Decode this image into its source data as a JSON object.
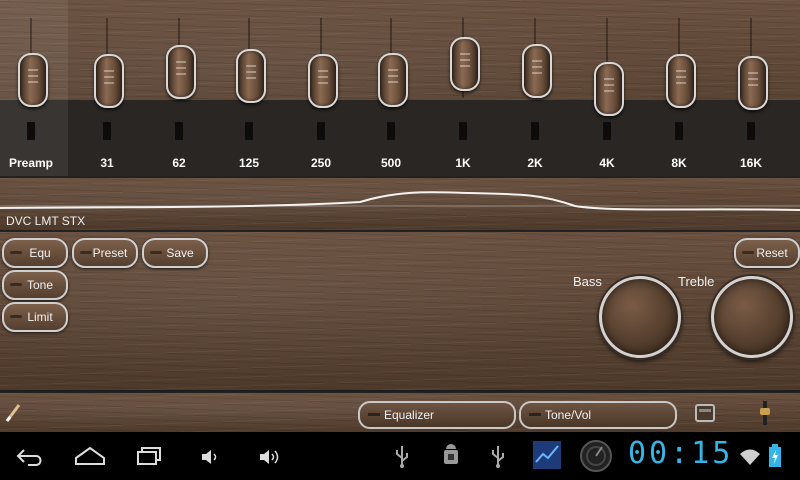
{
  "equalizer": {
    "bands": [
      {
        "label": "Preamp",
        "level": 0.57
      },
      {
        "label": "31",
        "level": 0.56
      },
      {
        "label": "62",
        "level": 0.72
      },
      {
        "label": "125",
        "level": 0.65
      },
      {
        "label": "250",
        "level": 0.55
      },
      {
        "label": "500",
        "level": 0.58
      },
      {
        "label": "1K",
        "level": 0.87
      },
      {
        "label": "2K",
        "level": 0.75
      },
      {
        "label": "4K",
        "level": 0.4
      },
      {
        "label": "8K",
        "level": 0.55
      },
      {
        "label": "16K",
        "level": 0.51
      }
    ]
  },
  "curve": {
    "status": "DVC LMT STX"
  },
  "controls": {
    "equ": "Equ",
    "tone": "Tone",
    "limit": "Limit",
    "preset": "Preset",
    "save": "Save",
    "reset": "Reset",
    "bass": "Bass",
    "treble": "Treble"
  },
  "bottom": {
    "equalizer_tab": "Equalizer",
    "tone_vol_tab": "Tone/Vol"
  },
  "system": {
    "clock": "00:15",
    "accent": "#33b5e5"
  }
}
